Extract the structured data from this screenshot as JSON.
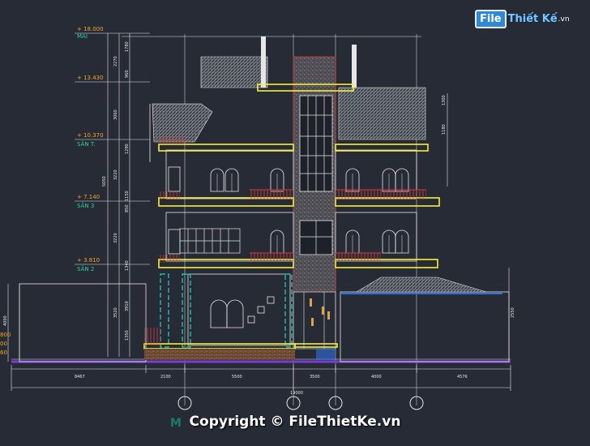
{
  "watermark": {
    "logo_box": "File",
    "logo_rest": "Thiết Kế",
    "logo_tld": ".vn",
    "copyright": "Copyright © FileThietKe.vn",
    "ghost_prefix": "M"
  },
  "levels": [
    {
      "elev": "+ 18.000",
      "name": "MÁI"
    },
    {
      "elev": "+ 13.430",
      "name": ""
    },
    {
      "elev": "+ 10.370",
      "name": "SÂN T."
    },
    {
      "elev": "+ 7.140",
      "name": "SÂN 3"
    },
    {
      "elev": "+ 3.810",
      "name": "SÂN 2"
    }
  ],
  "ground_partial": [
    "800",
    "00",
    "60"
  ],
  "vertical_dims": [
    "2270",
    "1780",
    "960",
    "3060",
    "1290",
    "3220",
    "3220",
    "1150",
    "850",
    "3520",
    "1340",
    "5050",
    "1350",
    "3910",
    "4000",
    "1300",
    "1180",
    "2550"
  ],
  "bottom_dims": [
    "8467",
    "2100",
    "5500",
    "3500",
    "4000",
    "4576"
  ],
  "total_dim": "19000",
  "colors": {
    "background": "#262b36",
    "line": "#f2f2f2",
    "slab": "#f7ef3a",
    "railing": "#d83a3a",
    "column": "#1fd6c2",
    "elevation_text": "#f5a623",
    "level_text": "#2fd39a",
    "ground": "#7a3fd1"
  }
}
